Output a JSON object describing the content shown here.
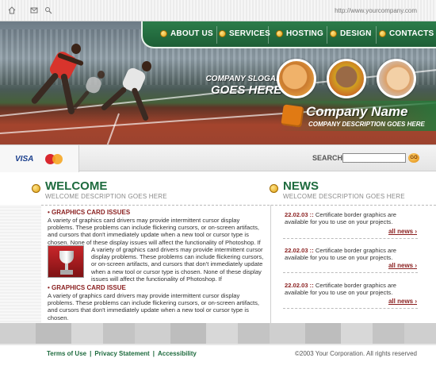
{
  "topbar": {
    "url": "http://www.yourcompany.com",
    "icons": [
      "home-icon",
      "mail-icon",
      "link-icon"
    ]
  },
  "nav": {
    "items": [
      {
        "label": "ABOUT US"
      },
      {
        "label": "SERVICES"
      },
      {
        "label": "HOSTING"
      },
      {
        "label": "DESIGN"
      },
      {
        "label": "CONTACTS"
      }
    ]
  },
  "hero": {
    "slogan_line1": "COMPANY SLOGAN",
    "slogan_line2": "GOES HERE",
    "company_name": "Company Name",
    "company_desc": "COMPANY DESCRIPTION GOES HERE"
  },
  "payments": {
    "visa": "VISA",
    "mastercard": "MasterCard"
  },
  "search": {
    "label": "SEARCH:",
    "value": "",
    "button": "GO"
  },
  "welcome": {
    "title": "WELCOME",
    "desc": "WELCOME DESCRIPTION GOES HERE",
    "issue1_title": "GRAPHICS CARD ISSUES",
    "issue1_body": "A variety of graphics card drivers may provide intermittent cursor display problems. These problems can include flickering cursors, or on-screen artifacts, and cursors that don't immediately update when a new tool or cursor type is chosen. None of these display issues will affect the functionality of Photoshop. If you are",
    "issue2_body": "A variety of graphics card drivers may provide intermittent cursor display problems. These problems can include flickering cursors, or on-screen artifacts, and cursors that don't immediately update when a new tool or cursor type is chosen. None of these display issues will affect the functionality of Photoshop. If",
    "issue3_title": "GRAPHICS CARD ISSUE",
    "issue3_body": "A variety of graphics card drivers may provide intermittent cursor display problems. These problems can include flickering cursors, or on-screen artifacts, and cursors that don't immediately update when a new tool or cursor type is chosen."
  },
  "news": {
    "title": "NEWS",
    "desc": "WELCOME DESCRIPTION GOES HERE",
    "items": [
      {
        "date": "22.02.03 ::",
        "text": "Certificate border graphics are available for you to use on your projects.",
        "link": "all news"
      },
      {
        "date": "22.02.03 ::",
        "text": "Certificate border graphics are available for you to use on your projects.",
        "link": "all news"
      },
      {
        "date": "22.02.03 ::",
        "text": "Certificate border graphics are available for you to use on your projects.",
        "link": "all news"
      }
    ]
  },
  "footer": {
    "links": [
      {
        "label": "Terms of Use"
      },
      {
        "label": "Privacy Statement"
      },
      {
        "label": "Accessibility"
      }
    ],
    "separator": "|",
    "copyright": "©2003 Your Corporation. All rights reserved"
  },
  "colors": {
    "brand_green": "#1e6b3e",
    "accent_red": "#8a1f1f",
    "accent_orange": "#e08a10"
  }
}
